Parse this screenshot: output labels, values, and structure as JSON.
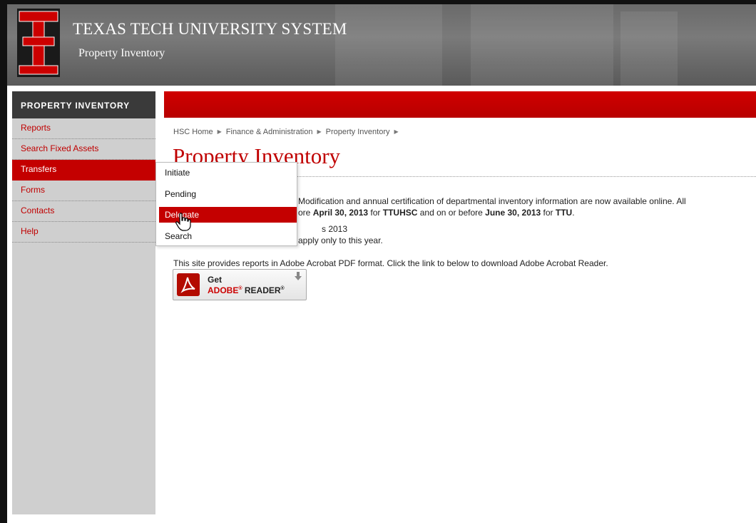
{
  "header": {
    "title": "TEXAS TECH UNIVERSITY SYSTEM",
    "subtitle": "Property Inventory"
  },
  "sidebar": {
    "heading": "PROPERTY INVENTORY",
    "items": [
      {
        "label": "Reports"
      },
      {
        "label": "Search Fixed Assets"
      },
      {
        "label": "Transfers",
        "active": true
      },
      {
        "label": "Forms"
      },
      {
        "label": "Contacts"
      },
      {
        "label": "Help"
      }
    ]
  },
  "breadcrumb": {
    "items": [
      "HSC Home",
      "Finance & Administration",
      "Property Inventory"
    ]
  },
  "page": {
    "title": "Property Inventory"
  },
  "content": {
    "p1": {
      "line1": "Modification and annual certification of departmental inventory information are now available online. All",
      "line2_pre": "ore ",
      "line2_b1": "April 30, 2013",
      "line2_mid1": " for ",
      "line2_b2": "TTUHSC",
      "line2_mid2": " and on or before ",
      "line2_b3": "June 30, 2013",
      "line2_mid3": " for ",
      "line2_b4": "TTU",
      "line2_end": "."
    },
    "p2": {
      "line1": "s 2013",
      "line2": "apply only to this year."
    },
    "p3": "This site provides reports in Adobe Acrobat PDF format.  Click the link to below to download Adobe Acrobat Reader.",
    "acrobat": {
      "get": "Get",
      "brand": "ADOBE",
      "product": "READER"
    }
  },
  "dropdown": {
    "items": [
      "Initiate",
      "Pending",
      "Delegate",
      "Search"
    ],
    "highlighted": "Delegate"
  },
  "colors": {
    "brand_red": "#c40000",
    "sidebar_bg": "#cfcfcf",
    "sidebar_head": "#3a3a3a"
  }
}
